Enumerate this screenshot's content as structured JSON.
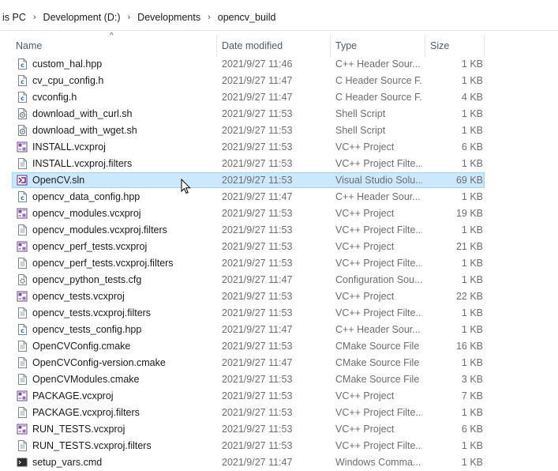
{
  "breadcrumb": [
    "is PC",
    "Development (D:)",
    "Developments",
    "opencv_build"
  ],
  "columns": {
    "name": "Name",
    "date": "Date modified",
    "type": "Type",
    "size": "Size"
  },
  "files": [
    {
      "name": "custom_hal.hpp",
      "date": "2021/9/27 11:46",
      "type": "C++ Header Sour...",
      "size": "1 KB",
      "icon": "code-file-icon"
    },
    {
      "name": "cv_cpu_config.h",
      "date": "2021/9/27 11:47",
      "type": "C Header Source F...",
      "size": "1 KB",
      "icon": "code-file-icon"
    },
    {
      "name": "cvconfig.h",
      "date": "2021/9/27 11:47",
      "type": "C Header Source F...",
      "size": "4 KB",
      "icon": "code-file-icon"
    },
    {
      "name": "download_with_curl.sh",
      "date": "2021/9/27 11:53",
      "type": "Shell Script",
      "size": "1 KB",
      "icon": "shell-script-icon"
    },
    {
      "name": "download_with_wget.sh",
      "date": "2021/9/27 11:53",
      "type": "Shell Script",
      "size": "1 KB",
      "icon": "shell-script-icon"
    },
    {
      "name": "INSTALL.vcxproj",
      "date": "2021/9/27 11:53",
      "type": "VC++ Project",
      "size": "6 KB",
      "icon": "vcxproj-icon"
    },
    {
      "name": "INSTALL.vcxproj.filters",
      "date": "2021/9/27 11:53",
      "type": "VC++ Project Filte...",
      "size": "1 KB",
      "icon": "text-file-icon"
    },
    {
      "name": "OpenCV.sln",
      "date": "2021/9/27 11:53",
      "type": "Visual Studio Solu...",
      "size": "69 KB",
      "icon": "solution-file-icon",
      "selected": true
    },
    {
      "name": "opencv_data_config.hpp",
      "date": "2021/9/27 11:47",
      "type": "C++ Header Sour...",
      "size": "1 KB",
      "icon": "code-file-icon"
    },
    {
      "name": "opencv_modules.vcxproj",
      "date": "2021/9/27 11:53",
      "type": "VC++ Project",
      "size": "19 KB",
      "icon": "vcxproj-icon"
    },
    {
      "name": "opencv_modules.vcxproj.filters",
      "date": "2021/9/27 11:53",
      "type": "VC++ Project Filte...",
      "size": "1 KB",
      "icon": "text-file-icon"
    },
    {
      "name": "opencv_perf_tests.vcxproj",
      "date": "2021/9/27 11:53",
      "type": "VC++ Project",
      "size": "21 KB",
      "icon": "vcxproj-icon"
    },
    {
      "name": "opencv_perf_tests.vcxproj.filters",
      "date": "2021/9/27 11:53",
      "type": "VC++ Project Filte...",
      "size": "1 KB",
      "icon": "text-file-icon"
    },
    {
      "name": "opencv_python_tests.cfg",
      "date": "2021/9/27 11:47",
      "type": "Configuration Sou...",
      "size": "1 KB",
      "icon": "config-file-icon"
    },
    {
      "name": "opencv_tests.vcxproj",
      "date": "2021/9/27 11:53",
      "type": "VC++ Project",
      "size": "22 KB",
      "icon": "vcxproj-icon"
    },
    {
      "name": "opencv_tests.vcxproj.filters",
      "date": "2021/9/27 11:53",
      "type": "VC++ Project Filte...",
      "size": "1 KB",
      "icon": "text-file-icon"
    },
    {
      "name": "opencv_tests_config.hpp",
      "date": "2021/9/27 11:47",
      "type": "C++ Header Sour...",
      "size": "1 KB",
      "icon": "code-file-icon"
    },
    {
      "name": "OpenCVConfig.cmake",
      "date": "2021/9/27 11:53",
      "type": "CMake Source File",
      "size": "16 KB",
      "icon": "text-file-icon"
    },
    {
      "name": "OpenCVConfig-version.cmake",
      "date": "2021/9/27 11:47",
      "type": "CMake Source File",
      "size": "1 KB",
      "icon": "text-file-icon"
    },
    {
      "name": "OpenCVModules.cmake",
      "date": "2021/9/27 11:53",
      "type": "CMake Source File",
      "size": "3 KB",
      "icon": "text-file-icon"
    },
    {
      "name": "PACKAGE.vcxproj",
      "date": "2021/9/27 11:53",
      "type": "VC++ Project",
      "size": "7 KB",
      "icon": "vcxproj-icon"
    },
    {
      "name": "PACKAGE.vcxproj.filters",
      "date": "2021/9/27 11:53",
      "type": "VC++ Project Filte...",
      "size": "1 KB",
      "icon": "text-file-icon"
    },
    {
      "name": "RUN_TESTS.vcxproj",
      "date": "2021/9/27 11:53",
      "type": "VC++ Project",
      "size": "6 KB",
      "icon": "vcxproj-icon"
    },
    {
      "name": "RUN_TESTS.vcxproj.filters",
      "date": "2021/9/27 11:53",
      "type": "VC++ Project Filte...",
      "size": "1 KB",
      "icon": "text-file-icon"
    },
    {
      "name": "setup_vars.cmd",
      "date": "2021/9/27 11:47",
      "type": "Windows Comma...",
      "size": "1 KB",
      "icon": "cmd-file-icon"
    }
  ],
  "colors": {
    "selection_bg": "#cce8ff",
    "selection_border": "#99d1ff",
    "header_text": "#4d5b6e"
  }
}
